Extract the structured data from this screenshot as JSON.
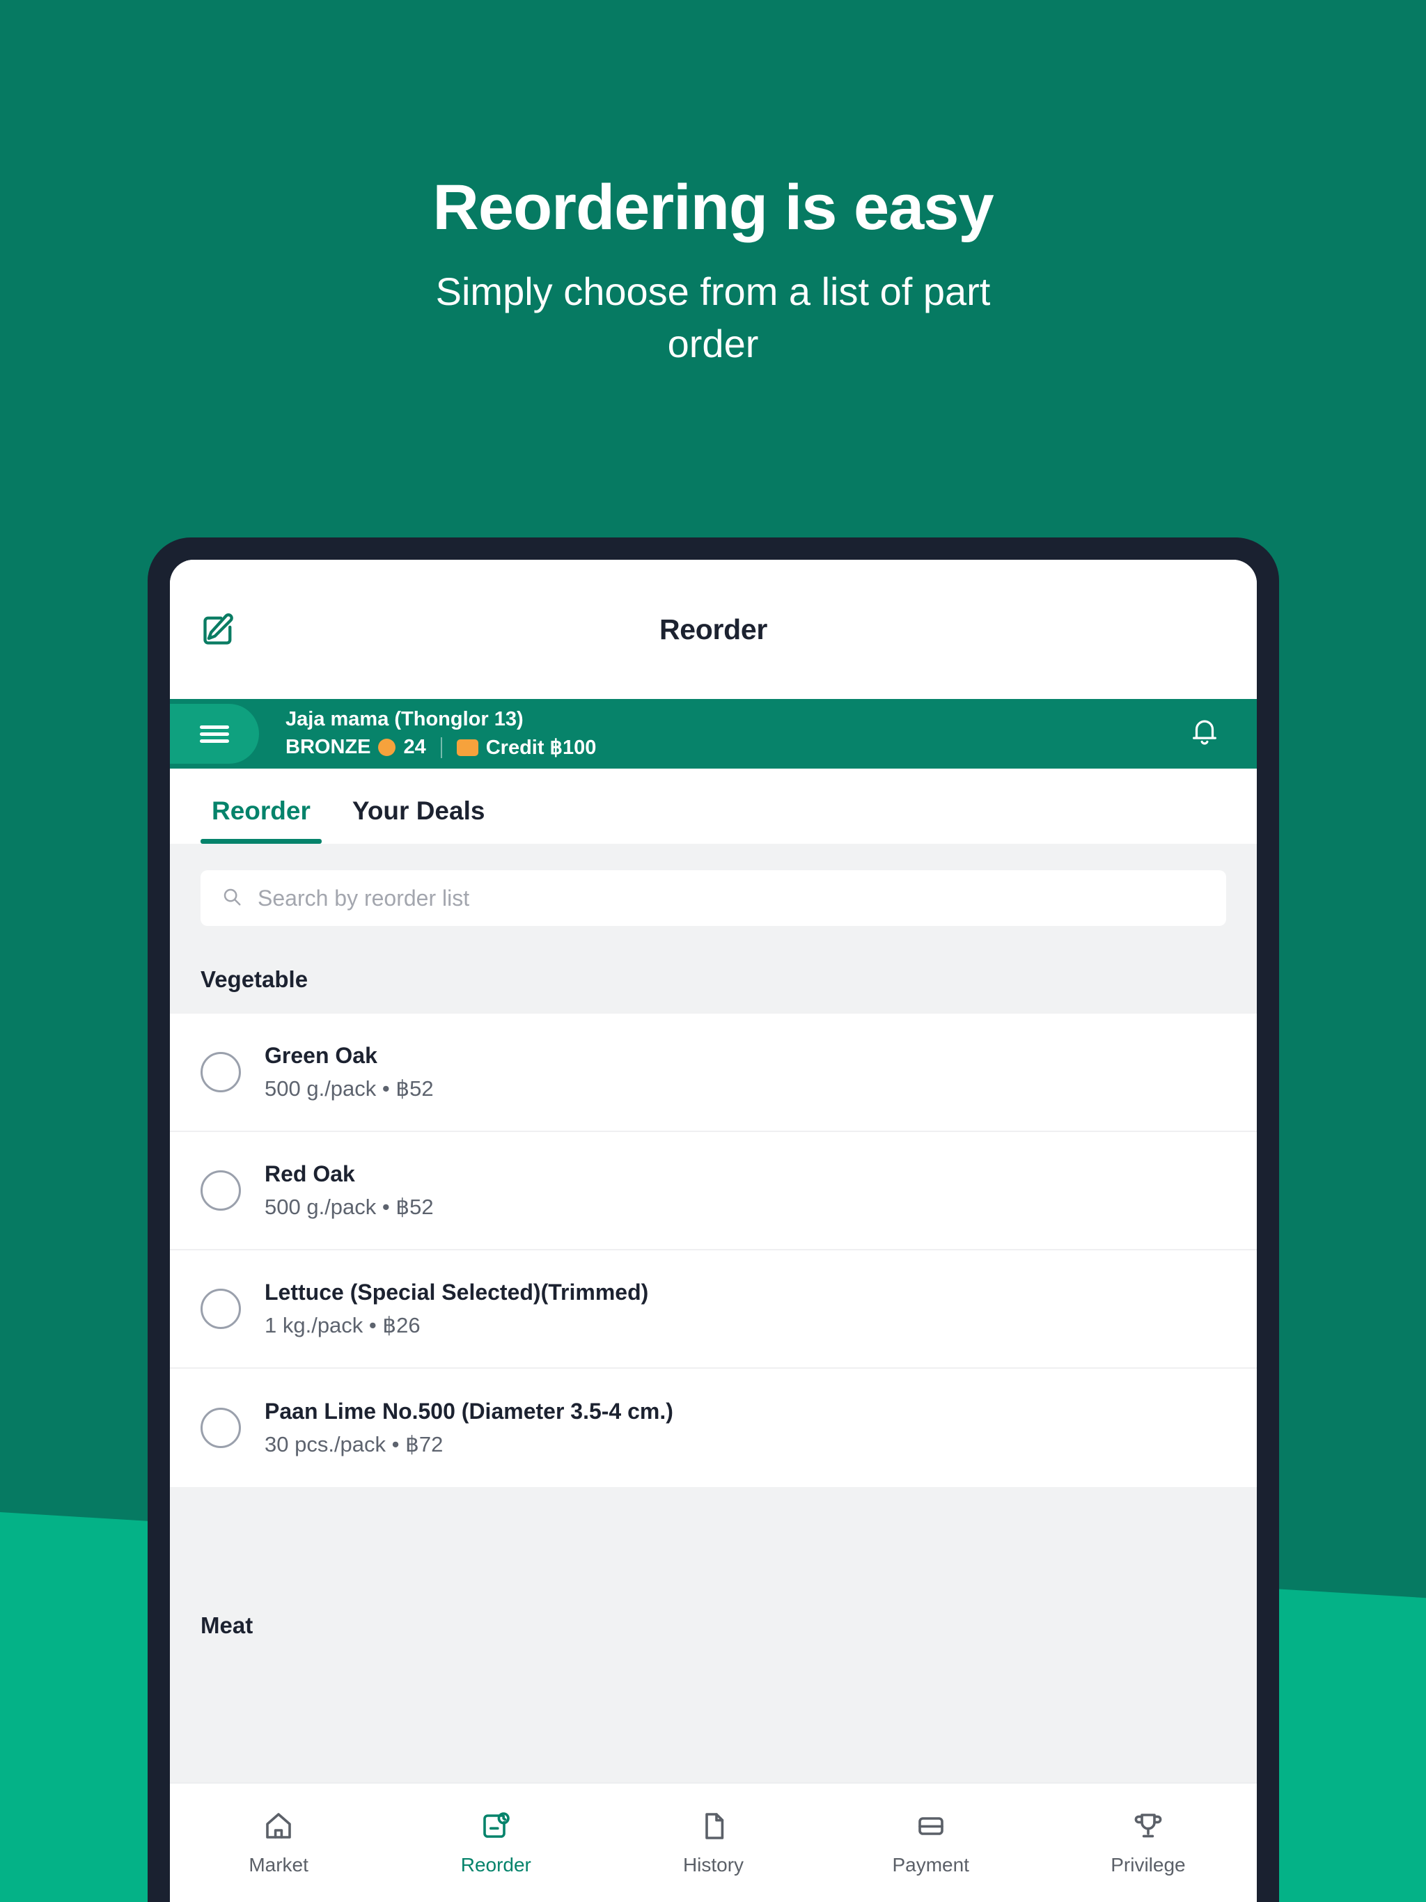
{
  "promo": {
    "title": "Reordering is easy",
    "subtitle": "Simply choose from a list of part order"
  },
  "colors": {
    "bg_top": "#067A62",
    "bg_bottom": "#04B287",
    "brand_green": "#05836B",
    "header_green": "#07836A",
    "hamburger_green": "#0FA17F",
    "bezel": "#1A2130",
    "accent_orange": "#F6A23C",
    "surface_gray": "#F1F2F3"
  },
  "appbar": {
    "title": "Reorder",
    "edit_icon": "edit-square-icon"
  },
  "storebar": {
    "menu_icon": "hamburger-menu-icon",
    "store_name": "Jaja mama (Thonglor 13)",
    "tier": "BRONZE",
    "points": "24",
    "credit_label": "Credit ฿100",
    "coin_icon": "coin-icon",
    "credit_icon": "credit-card-icon",
    "bell_icon": "notification-bell-icon"
  },
  "tabs": [
    {
      "label": "Reorder",
      "active": true
    },
    {
      "label": "Your Deals",
      "active": false
    }
  ],
  "search": {
    "placeholder": "Search by reorder list",
    "value": "",
    "icon": "search-icon"
  },
  "sections": [
    {
      "title": "Vegetable",
      "items": [
        {
          "name": "Green Oak",
          "sub": "500 g./pack • ฿52"
        },
        {
          "name": "Red Oak",
          "sub": "500 g./pack • ฿52"
        },
        {
          "name": "Lettuce (Special Selected)(Trimmed)",
          "sub": "1 kg./pack • ฿26"
        },
        {
          "name": "Paan Lime No.500 (Diameter 3.5-4 cm.)",
          "sub": "30 pcs./pack • ฿72"
        }
      ]
    },
    {
      "title": "Meat",
      "items": []
    }
  ],
  "bottom_nav": [
    {
      "label": "Market",
      "icon": "home-icon",
      "active": false
    },
    {
      "label": "Reorder",
      "icon": "reorder-clock-icon",
      "active": true
    },
    {
      "label": "History",
      "icon": "document-icon",
      "active": false
    },
    {
      "label": "Payment",
      "icon": "credit-card-icon",
      "active": false
    },
    {
      "label": "Privilege",
      "icon": "trophy-icon",
      "active": false
    }
  ]
}
